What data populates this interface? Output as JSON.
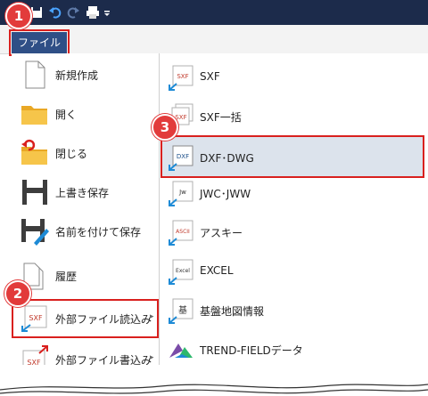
{
  "ribbon": {
    "file_tab": "ファイル"
  },
  "badges": {
    "one": "1",
    "two": "2",
    "three": "3"
  },
  "icon_labels": {
    "sxf": "SXF",
    "dxf": "DXF",
    "jw": "Jw",
    "ascii": "ASCII",
    "excel": "Excel",
    "kiban": "基"
  },
  "left_menu": [
    {
      "label": "新規作成",
      "icon": "new-document-icon"
    },
    {
      "label": "開く",
      "icon": "folder-open-icon"
    },
    {
      "label": "閉じる",
      "icon": "folder-close-icon"
    },
    {
      "label": "上書き保存",
      "icon": "save-icon"
    },
    {
      "label": "名前を付けて保存",
      "icon": "save-as-icon"
    },
    {
      "label": "履歴",
      "icon": "history-icon"
    },
    {
      "label": "外部ファイル読込み",
      "icon": "import-icon",
      "arrow": "▸"
    },
    {
      "label": "外部ファイル書込み",
      "icon": "export-icon",
      "arrow": "▸"
    }
  ],
  "right_menu": [
    {
      "label": "SXF"
    },
    {
      "label": "SXF一括"
    },
    {
      "label": "DXF･DWG"
    },
    {
      "label": "JWC･JWW"
    },
    {
      "label": "アスキー"
    },
    {
      "label": "EXCEL"
    },
    {
      "label": "基盤地図情報"
    },
    {
      "label": "TREND-FIELDデータ"
    }
  ],
  "colors": {
    "titlebar": "#1c2b4b",
    "file_tab": "#2f4f86",
    "highlight": "#d9201e",
    "badge": "#e23b3b",
    "selected": "#dce3ec"
  }
}
